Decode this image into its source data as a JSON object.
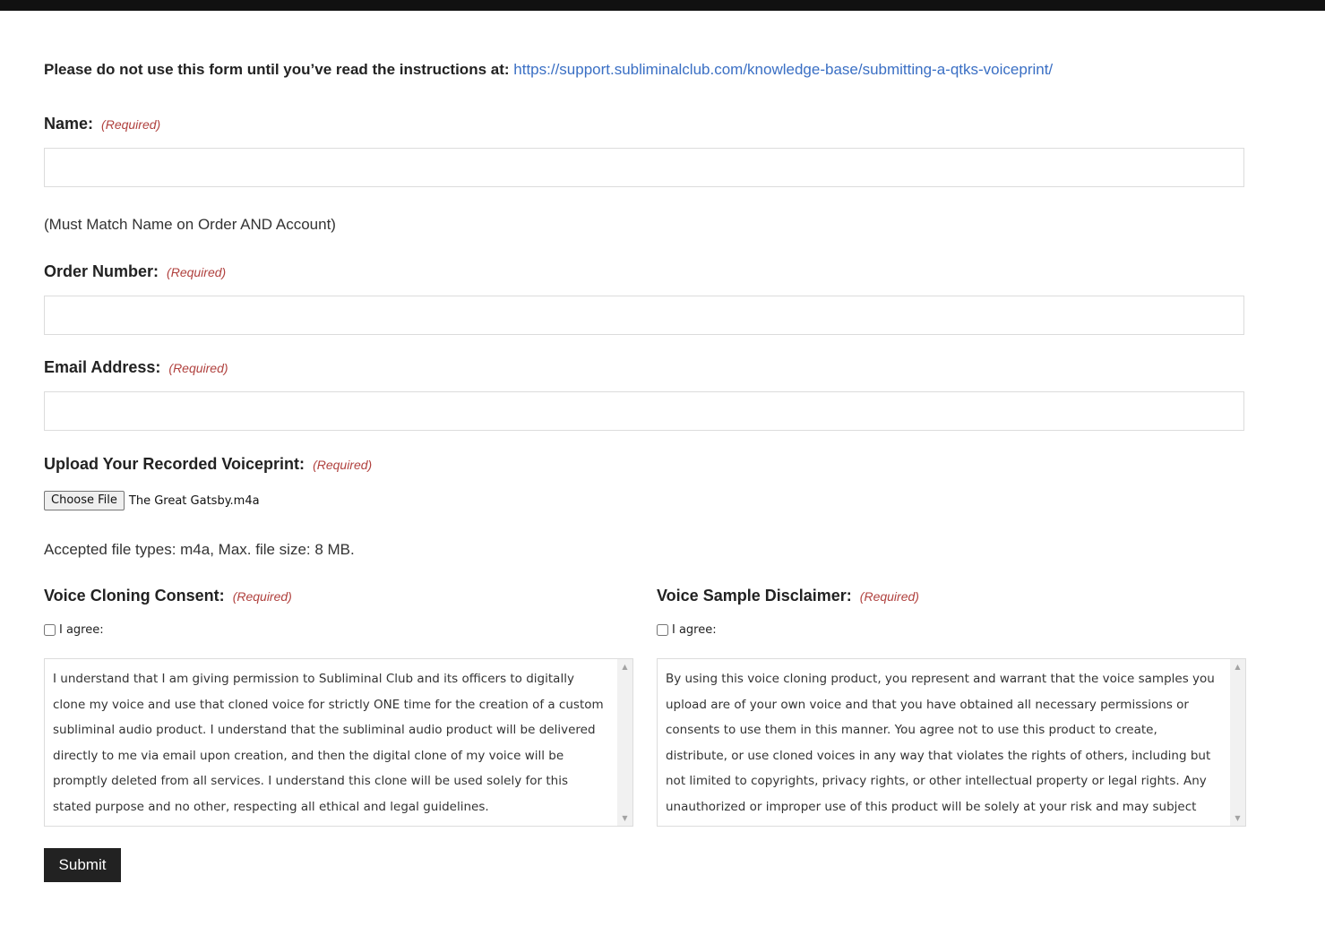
{
  "intro": {
    "text": "Please do not use this form until you’ve read the instructions at:",
    "link": "https://support.subliminalclub.com/knowledge-base/submitting-a-qtks-voiceprint/"
  },
  "required_text": "(Required)",
  "name_field": {
    "label": "Name:",
    "value": "",
    "helper": "(Must Match Name on Order AND Account)"
  },
  "order_field": {
    "label": "Order Number:",
    "value": ""
  },
  "email_field": {
    "label": "Email Address:",
    "value": ""
  },
  "upload_field": {
    "label": "Upload Your Recorded Voiceprint:",
    "button_label": "Choose File",
    "file_name": "The Great Gatsby.m4a",
    "helper": "Accepted file types: m4a, Max. file size: 8 MB."
  },
  "consent": {
    "label": "Voice Cloning Consent:",
    "checkbox_label": "I agree:",
    "checked": false,
    "text": "I understand that I am giving permission to Subliminal Club and its officers to digitally clone my voice and use that cloned voice for strictly ONE time for the creation of a custom subliminal audio product. I understand that the subliminal audio product will be delivered directly to me via email upon creation, and then the digital clone of my voice will be promptly deleted from all services. I understand this clone will be used solely for this stated purpose and no other, respecting all ethical and legal guidelines."
  },
  "disclaimer": {
    "label": "Voice Sample Disclaimer:",
    "checkbox_label": "I agree:",
    "checked": false,
    "text": "By using this voice cloning product, you represent and warrant that the voice samples you upload are of your own voice and that you have obtained all necessary permissions or consents to use them in this manner. You agree not to use this product to create, distribute, or use cloned voices in any way that violates the rights of others, including but not limited to copyrights, privacy rights, or other intellectual property or legal rights. Any unauthorized or improper use of this product will be solely at your risk and may subject you to legal liability."
  },
  "submit": {
    "label": "Submit"
  },
  "colors": {
    "link": "#3a6fc4",
    "required": "#b0413e",
    "submit_bg": "#222222",
    "top_bar": "#111111"
  }
}
